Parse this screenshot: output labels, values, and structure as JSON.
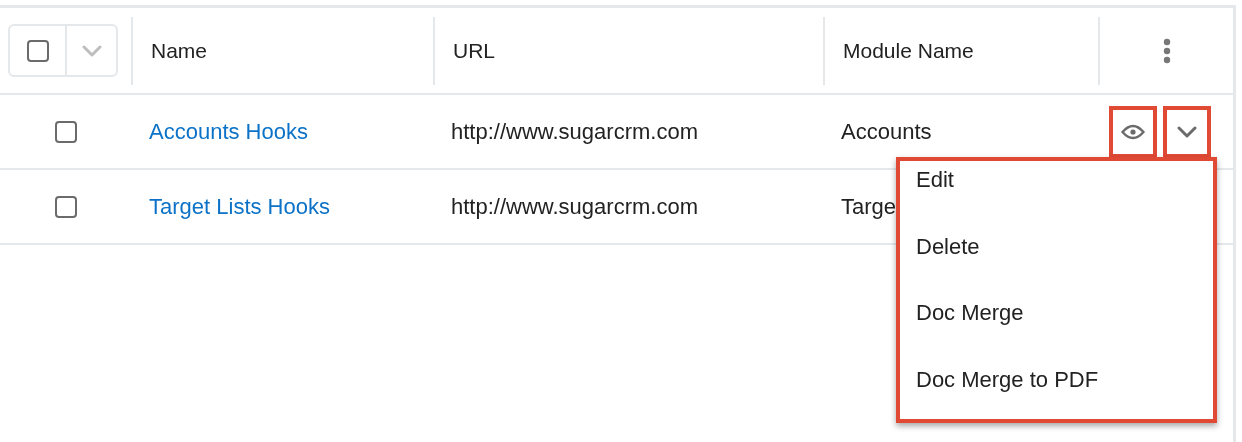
{
  "table": {
    "columns": [
      {
        "label": "Name"
      },
      {
        "label": "URL"
      },
      {
        "label": "Module Name"
      }
    ],
    "rows": [
      {
        "checked": false,
        "name": "Accounts Hooks",
        "url": "http://www.sugarcrm.com",
        "module": "Accounts",
        "actions": {
          "highlighted": true
        }
      },
      {
        "checked": false,
        "name": "Target Lists Hooks",
        "url": "http://www.sugarcrm.com",
        "module": "Targe"
      }
    ]
  },
  "header_select": {
    "checked": false
  },
  "action_menu": {
    "highlighted": true,
    "items": [
      {
        "label": "Edit"
      },
      {
        "label": "Delete"
      },
      {
        "label": "Doc Merge"
      },
      {
        "label": "Doc Merge to PDF"
      }
    ]
  }
}
